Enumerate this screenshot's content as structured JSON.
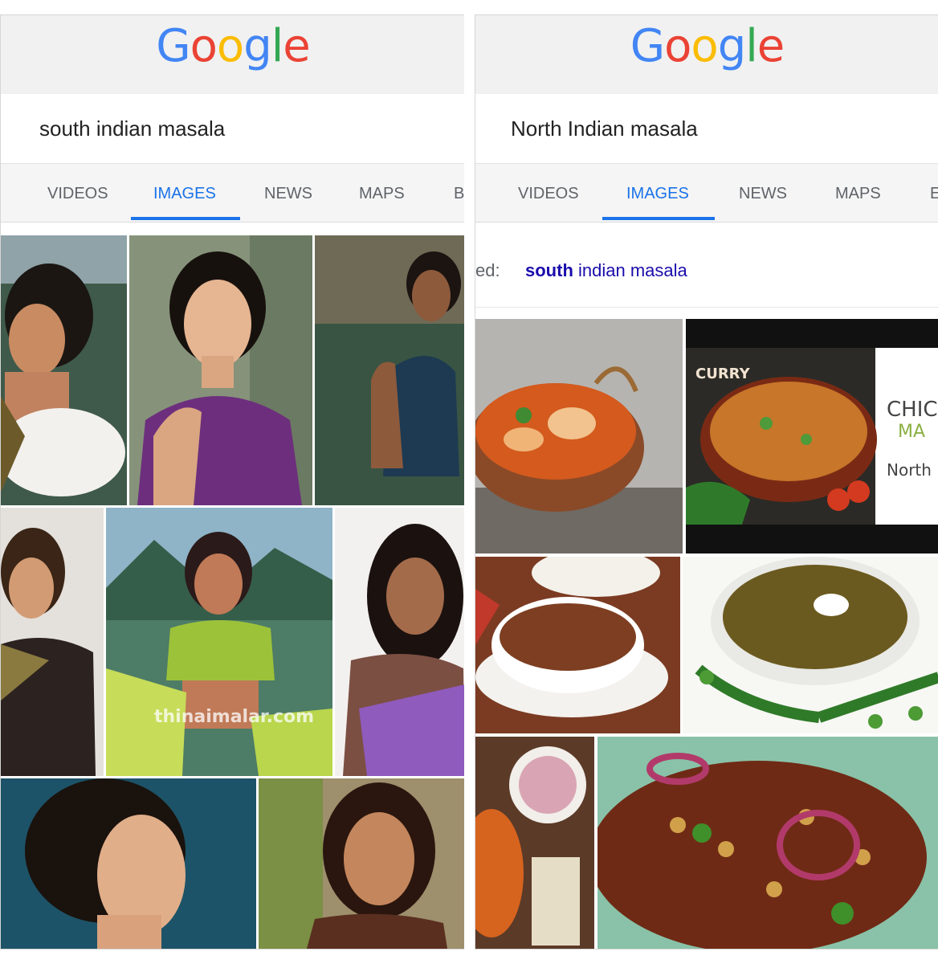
{
  "left_panel": {
    "logo": {
      "letters": [
        "G",
        "o",
        "o",
        "g",
        "l",
        "e"
      ],
      "colors": [
        "#4285f4",
        "#ea4335",
        "#fbbc05",
        "#4285f4",
        "#34a853",
        "#ea4335"
      ]
    },
    "search_query": "south indian masala",
    "tabs": [
      "VIDEOS",
      "IMAGES",
      "NEWS",
      "MAPS",
      "B"
    ],
    "active_tab": "IMAGES",
    "images": [
      {
        "icon": "woman-portrait-photo",
        "watermark": ""
      },
      {
        "icon": "woman-purple-tshirt-photo",
        "watermark": ""
      },
      {
        "icon": "woman-in-water-photo",
        "watermark": ""
      },
      {
        "icon": "woman-saree-photo",
        "watermark": ""
      },
      {
        "icon": "woman-green-blouse-photo",
        "watermark": "thinaimalar.com"
      },
      {
        "icon": "woman-purple-saree-photo",
        "watermark": ""
      },
      {
        "icon": "woman-profile-photo",
        "watermark": ""
      },
      {
        "icon": "woman-smiling-photo",
        "watermark": ""
      }
    ]
  },
  "right_panel": {
    "logo": {
      "letters": [
        "G",
        "o",
        "o",
        "g",
        "l",
        "e"
      ],
      "colors": [
        "#4285f4",
        "#ea4335",
        "#fbbc05",
        "#4285f4",
        "#34a853",
        "#ea4335"
      ]
    },
    "search_query": "North Indian masala",
    "tabs": [
      "VIDEOS",
      "IMAGES",
      "NEWS",
      "MAPS",
      "E"
    ],
    "active_tab": "IMAGES",
    "suggestion": {
      "prefix": "ed:",
      "bold": "south",
      "rest": " indian masala"
    },
    "images": [
      {
        "icon": "curry-in-copper-pot-photo",
        "label": ""
      },
      {
        "icon": "curry-bowl-photo",
        "label": "CURRY",
        "side_text_1": "CHIC",
        "side_text_2": "MA",
        "side_text_3": "North"
      },
      {
        "icon": "dal-bowl-photo",
        "label": ""
      },
      {
        "icon": "peas-curry-bowl-photo",
        "label": ""
      },
      {
        "icon": "onion-bowl-photo",
        "label": ""
      },
      {
        "icon": "chole-masala-photo",
        "label": ""
      }
    ]
  }
}
